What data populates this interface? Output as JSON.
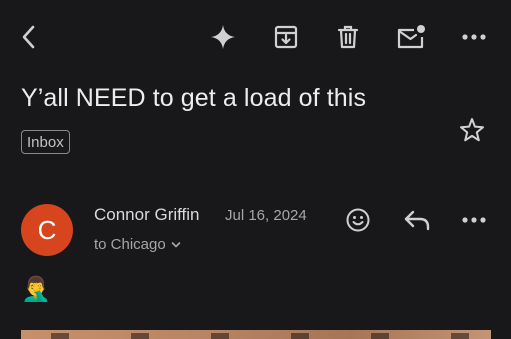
{
  "toolbar": {
    "back_icon": "chevron-left-icon",
    "ai_icon": "sparkle-icon",
    "archive_icon": "archive-icon",
    "delete_icon": "trash-icon",
    "mark_unread_icon": "mail-unread-icon",
    "more_icon": "more-horizontal-icon"
  },
  "email": {
    "subject": "Y’all NEED to get a load of this",
    "label": "Inbox",
    "star_icon": "star-outline-icon",
    "sender": {
      "initial": "C",
      "name": "Connor Griffin",
      "date": "Jul 16, 2024",
      "recipient": "to Chicago",
      "avatar_color": "#d6451d"
    },
    "actions": {
      "emoji_icon": "emoji-react-icon",
      "reply_icon": "reply-icon",
      "more_icon": "more-horizontal-icon"
    },
    "body_emoji": "🤦‍♂️"
  },
  "colors": {
    "background": "#18181a",
    "text_primary": "#ededf0",
    "text_secondary": "#a6a6aa",
    "icon": "#d0d0d4"
  }
}
